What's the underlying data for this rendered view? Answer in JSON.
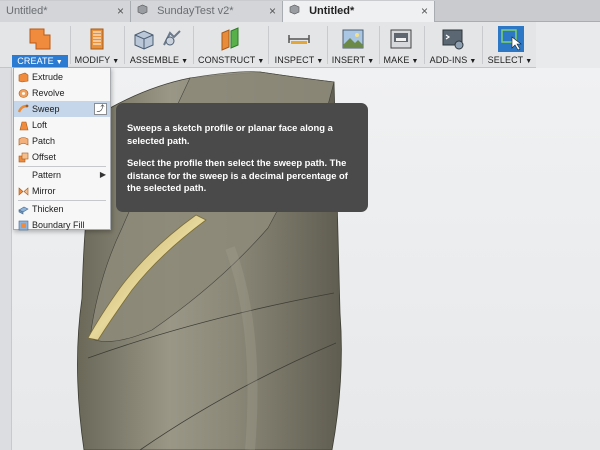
{
  "tabs": [
    {
      "label": "Untitled*",
      "active": false
    },
    {
      "label": "SundayTest v2*",
      "active": false
    },
    {
      "label": "Untitled*",
      "active": true
    }
  ],
  "tab_close_glyph": "×",
  "toolbar": {
    "groups": [
      {
        "label": "CREATE",
        "icon": "create-box-icon"
      },
      {
        "label": "MODIFY",
        "icon": "modify-icon"
      },
      {
        "label": "ASSEMBLE",
        "icon": "assemble-icon"
      },
      {
        "label": "CONSTRUCT",
        "icon": "construct-plane-icon"
      },
      {
        "label": "INSPECT",
        "icon": "measure-icon"
      },
      {
        "label": "INSERT",
        "icon": "insert-image-icon"
      },
      {
        "label": "MAKE",
        "icon": "print-icon"
      },
      {
        "label": "ADD-INS",
        "icon": "addins-icon"
      },
      {
        "label": "SELECT",
        "icon": "select-cursor-icon"
      }
    ],
    "caret": "▼"
  },
  "create_menu": {
    "items": [
      {
        "label": "Extrude",
        "icon": "extrude-icon"
      },
      {
        "label": "Revolve",
        "icon": "revolve-icon"
      },
      {
        "label": "Sweep",
        "icon": "sweep-icon",
        "hovered": true
      },
      {
        "label": "Loft",
        "icon": "loft-icon"
      },
      {
        "label": "Patch",
        "icon": "patch-icon"
      },
      {
        "label": "Offset",
        "icon": "offset-icon"
      },
      {
        "label": "Pattern",
        "icon": "",
        "submenu": true
      },
      {
        "label": "Mirror",
        "icon": "mirror-icon"
      },
      {
        "label": "Thicken",
        "icon": "thicken-icon"
      },
      {
        "label": "Boundary Fill",
        "icon": "boundary-fill-icon"
      }
    ],
    "submenu_arrow": "▶",
    "pin_glyph": "⤴"
  },
  "tooltip": {
    "line1": "Sweeps a sketch profile or planar face along a selected path.",
    "line2": "Select the profile then select the sweep path. The distance for the sweep is a decimal percentage of the selected path."
  },
  "colors": {
    "accent": "#2b7bd2",
    "model_body": "#7b7868",
    "sweep_band": "#c9b66a",
    "tooltip_bg": "#4a4a4a"
  }
}
